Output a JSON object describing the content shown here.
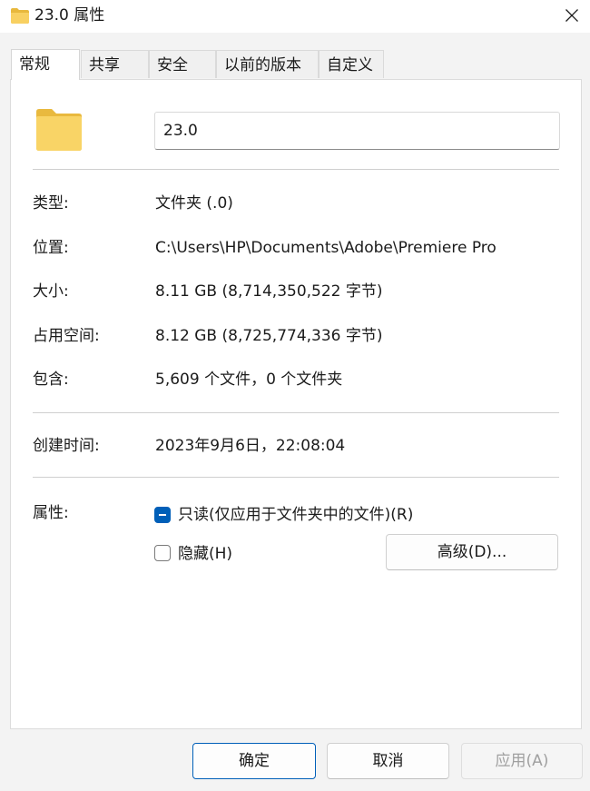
{
  "window": {
    "title": "23.0 属性",
    "title_icon": "folder-icon",
    "close_icon": "close-icon"
  },
  "tabs": [
    {
      "label": "常规",
      "active": true
    },
    {
      "label": "共享",
      "active": false
    },
    {
      "label": "安全",
      "active": false
    },
    {
      "label": "以前的版本",
      "active": false
    },
    {
      "label": "自定义",
      "active": false
    }
  ],
  "general": {
    "folder_icon": "folder-icon",
    "name_value": "23.0",
    "type_label": "类型:",
    "type_value": "文件夹 (.0)",
    "location_label": "位置:",
    "location_value": "C:\\Users\\HP\\Documents\\Adobe\\Premiere Pro",
    "size_label": "大小:",
    "size_value": "8.11 GB (8,714,350,522 字节)",
    "size_on_disk_label": "占用空间:",
    "size_on_disk_value": "8.12 GB (8,725,774,336 字节)",
    "contains_label": "包含:",
    "contains_value": "5,609 个文件，0 个文件夹",
    "created_label": "创建时间:",
    "created_value": "2023年9月6日，22:08:04",
    "attributes_label": "属性:",
    "readonly_label": "只读(仅应用于文件夹中的文件)(R)",
    "readonly_state": "indeterminate",
    "hidden_label": "隐藏(H)",
    "hidden_state": "unchecked",
    "advanced_button": "高级(D)..."
  },
  "footer": {
    "ok_label": "确定",
    "cancel_label": "取消",
    "apply_label": "应用(A)"
  },
  "colors": {
    "accent": "#005fb8",
    "folder_yellow": "#f8d061",
    "panel_bg": "#ffffff",
    "window_bg": "#f3f3f3"
  }
}
